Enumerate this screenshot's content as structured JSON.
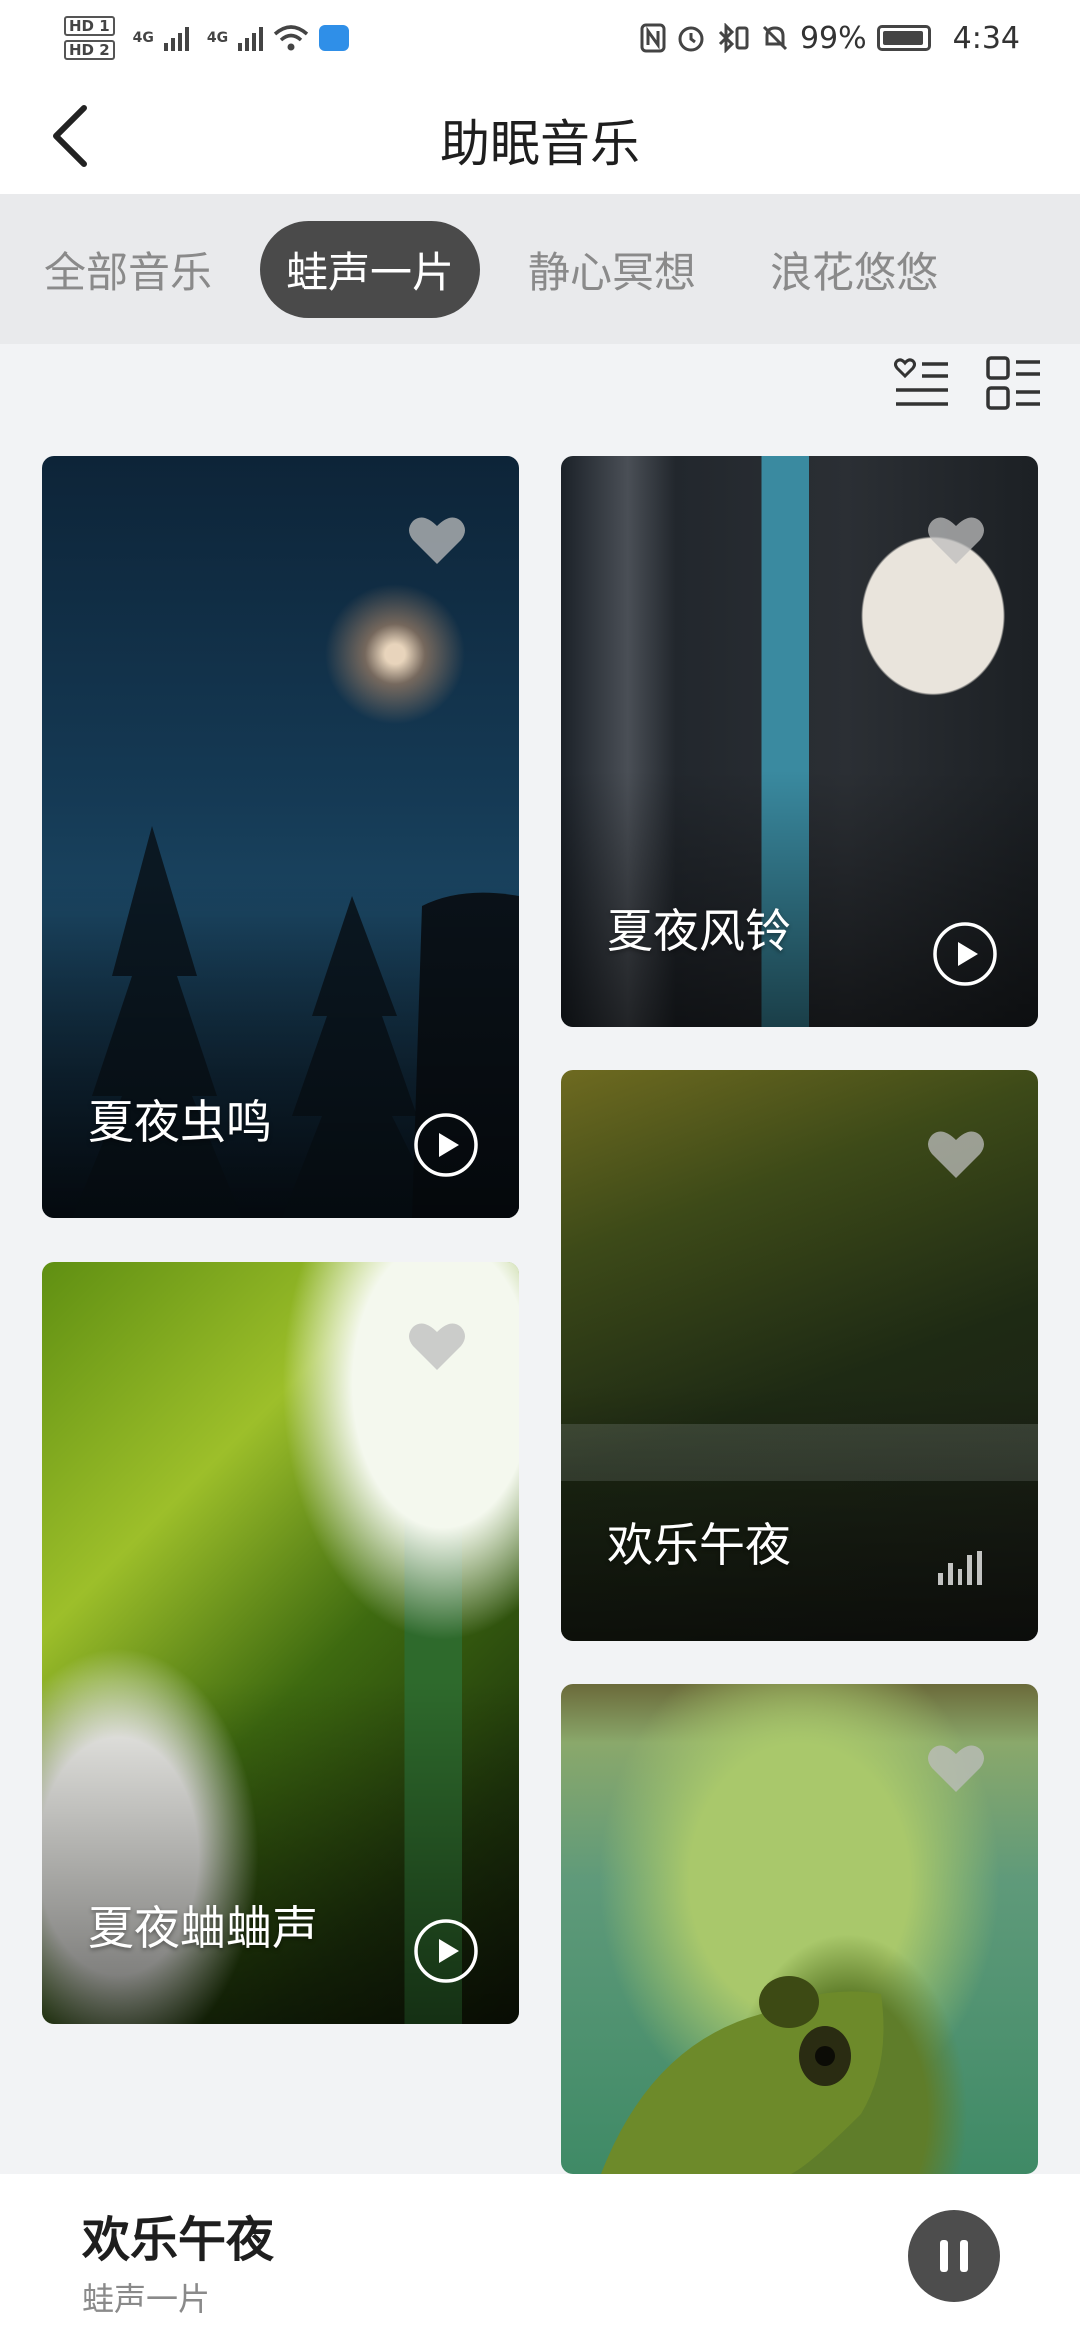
{
  "status_bar": {
    "sim_labels": [
      "HD 1",
      "HD 2"
    ],
    "network": [
      "4G",
      "4G"
    ],
    "battery_percent": "99%",
    "time": "4:34",
    "cloud_color": "#2f8fe8"
  },
  "header": {
    "title": "助眠音乐",
    "back_icon": "chevron-left-icon"
  },
  "tabs": [
    {
      "label": "全部音乐",
      "active": false
    },
    {
      "label": "蛙声一片",
      "active": true
    },
    {
      "label": "静心冥想",
      "active": false
    },
    {
      "label": "浪花悠悠",
      "active": false
    }
  ],
  "view_toggles": [
    "favorites-list-icon",
    "grid-list-icon"
  ],
  "cards": [
    {
      "title": "夏夜虫鸣",
      "favorite_icon": "heart-icon",
      "action_icon": "play-icon"
    },
    {
      "title": "夏夜风铃",
      "favorite_icon": "heart-icon",
      "action_icon": "play-icon"
    },
    {
      "title": "夏夜蛐蛐声",
      "favorite_icon": "heart-icon",
      "action_icon": "play-icon"
    },
    {
      "title": "欢乐午夜",
      "favorite_icon": "heart-icon",
      "action_icon": "equalizer-icon"
    },
    {
      "title": "",
      "favorite_icon": "heart-icon"
    }
  ],
  "player": {
    "title": "欢乐午夜",
    "subtitle": "蛙声一片",
    "control_icon": "pause-icon"
  },
  "colors": {
    "active_tab_bg": "#4a4a4a",
    "tab_bar_bg": "#e9eaec",
    "page_bg": "#f2f3f5",
    "pause_button": "#4d4d4d"
  }
}
